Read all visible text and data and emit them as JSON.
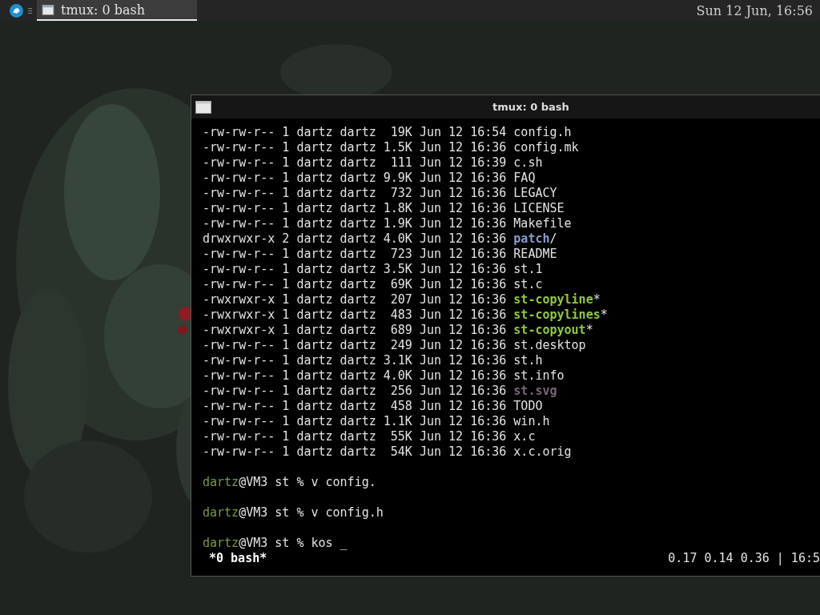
{
  "taskbar": {
    "window_button": {
      "title": "tmux: 0 bash",
      "selected": true
    },
    "clock": "Sun 12 Jun, 16:56"
  },
  "terminal": {
    "title": "tmux: 0 bash",
    "listing": [
      {
        "info": "-rw-rw-r-- 1 dartz dartz  19K Jun 12 16:54",
        "name": "config.h",
        "kind": "file"
      },
      {
        "info": "-rw-rw-r-- 1 dartz dartz 1.5K Jun 12 16:36",
        "name": "config.mk",
        "kind": "file"
      },
      {
        "info": "-rw-rw-r-- 1 dartz dartz  111 Jun 12 16:39",
        "name": "c.sh",
        "kind": "file"
      },
      {
        "info": "-rw-rw-r-- 1 dartz dartz 9.9K Jun 12 16:36",
        "name": "FAQ",
        "kind": "file"
      },
      {
        "info": "-rw-rw-r-- 1 dartz dartz  732 Jun 12 16:36",
        "name": "LEGACY",
        "kind": "file"
      },
      {
        "info": "-rw-rw-r-- 1 dartz dartz 1.8K Jun 12 16:36",
        "name": "LICENSE",
        "kind": "file"
      },
      {
        "info": "-rw-rw-r-- 1 dartz dartz 1.9K Jun 12 16:36",
        "name": "Makefile",
        "kind": "file"
      },
      {
        "info": "drwxrwxr-x 2 dartz dartz 4.0K Jun 12 16:36",
        "name": "patch",
        "suffix": "/",
        "kind": "dir"
      },
      {
        "info": "-rw-rw-r-- 1 dartz dartz  723 Jun 12 16:36",
        "name": "README",
        "kind": "file"
      },
      {
        "info": "-rw-rw-r-- 1 dartz dartz 3.5K Jun 12 16:36",
        "name": "st.1",
        "kind": "file"
      },
      {
        "info": "-rw-rw-r-- 1 dartz dartz  69K Jun 12 16:36",
        "name": "st.c",
        "kind": "file"
      },
      {
        "info": "-rwxrwxr-x 1 dartz dartz  207 Jun 12 16:36",
        "name": "st-copyline",
        "suffix": "*",
        "kind": "exec"
      },
      {
        "info": "-rwxrwxr-x 1 dartz dartz  483 Jun 12 16:36",
        "name": "st-copylines",
        "suffix": "*",
        "kind": "exec"
      },
      {
        "info": "-rwxrwxr-x 1 dartz dartz  689 Jun 12 16:36",
        "name": "st-copyout",
        "suffix": "*",
        "kind": "exec"
      },
      {
        "info": "-rw-rw-r-- 1 dartz dartz  249 Jun 12 16:36",
        "name": "st.desktop",
        "kind": "file"
      },
      {
        "info": "-rw-rw-r-- 1 dartz dartz 3.1K Jun 12 16:36",
        "name": "st.h",
        "kind": "file"
      },
      {
        "info": "-rw-rw-r-- 1 dartz dartz 4.0K Jun 12 16:36",
        "name": "st.info",
        "kind": "file"
      },
      {
        "info": "-rw-rw-r-- 1 dartz dartz  256 Jun 12 16:36",
        "name": "st.svg"
      },
      {
        "info": "-rw-rw-r-- 1 dartz dartz  458 Jun 12 16:36",
        "name": "TODO",
        "kind": "file"
      },
      {
        "info": "-rw-rw-r-- 1 dartz dartz 1.1K Jun 12 16:36",
        "name": "win.h",
        "kind": "file"
      },
      {
        "info": "-rw-rw-r-- 1 dartz dartz  55K Jun 12 16:36",
        "name": "x.c",
        "kind": "file"
      },
      {
        "info": "-rw-rw-r-- 1 dartz dartz  54K Jun 12 16:36",
        "name": "x.c.orig",
        "kind": "file"
      }
    ],
    "prompts": [
      {
        "user": "dartz",
        "command": "@VM3 st % v config."
      },
      {
        "user": "dartz",
        "command": "@VM3 st % v config.h"
      },
      {
        "user": "dartz",
        "command": "@VM3 st % kos _"
      }
    ],
    "status_bar": {
      "session": "*0 bash*",
      "load": "0.17 0.14 0.36 | 16:5"
    }
  }
}
